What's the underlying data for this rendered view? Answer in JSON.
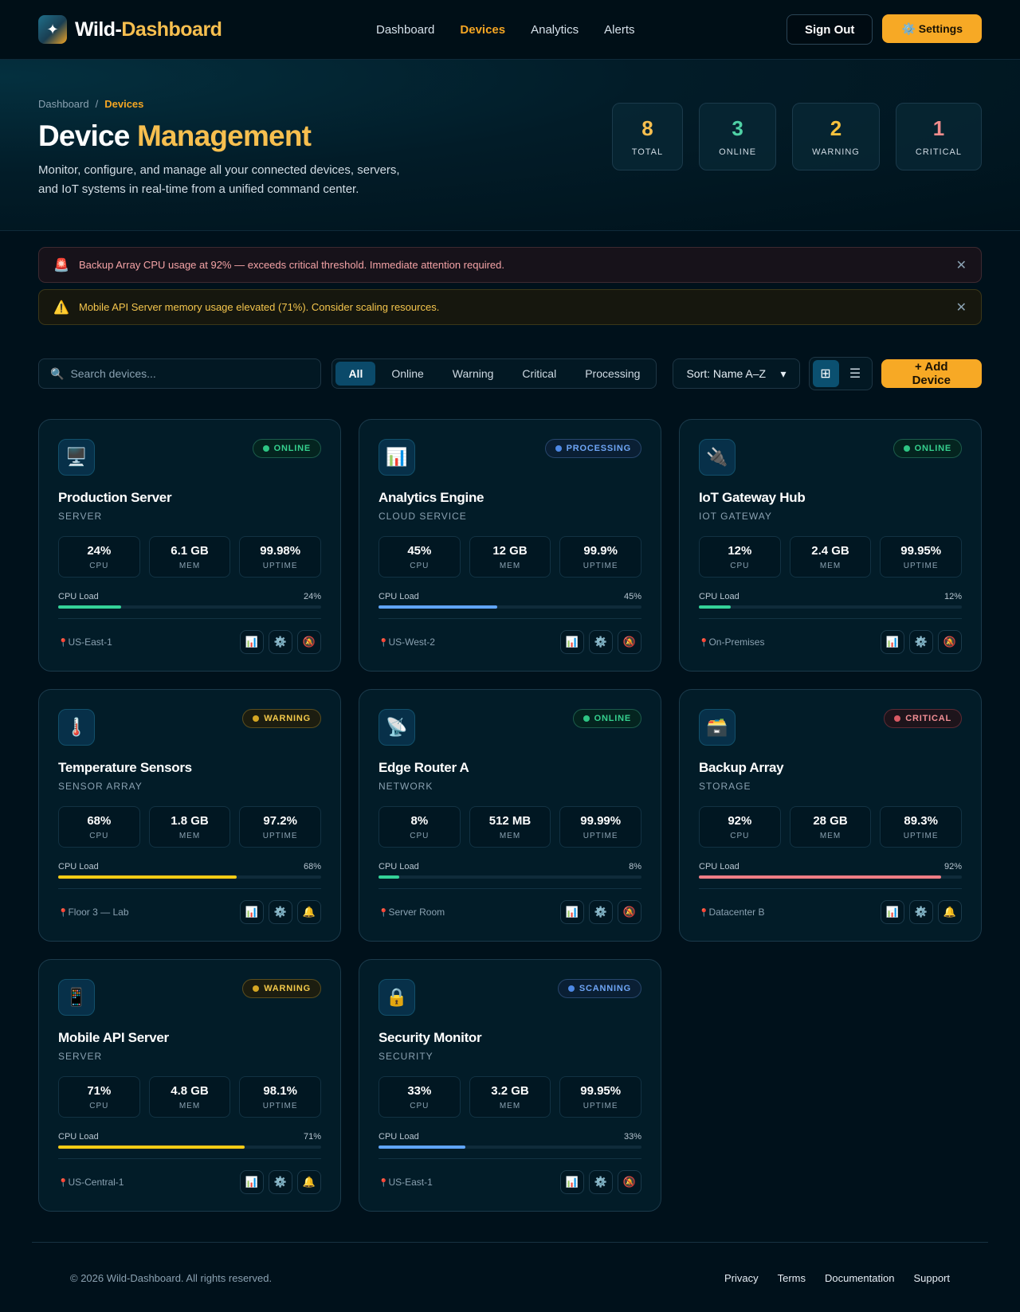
{
  "header": {
    "brand_logo_glyph": "✦",
    "brand_name_part1": "Wild-",
    "brand_name_part2": "Dashboard",
    "nav": [
      "Dashboard",
      "Devices",
      "Analytics",
      "Alerts"
    ],
    "active_nav": "Devices",
    "sign_out_label": "Sign Out",
    "settings_label": "⚙️ Settings"
  },
  "hero": {
    "breadcrumb_root": "Dashboard",
    "breadcrumb_sep": "/",
    "breadcrumb_current": "Devices",
    "title_part1": "Device",
    "title_part2": "Management",
    "description": "Monitor, configure, and manage all your connected devices, servers, and IoT systems in real-time from a unified command center.",
    "stats": [
      {
        "value": "8",
        "label": "TOTAL",
        "color": "#f7bf4f"
      },
      {
        "value": "3",
        "label": "ONLINE",
        "color": "#4fd1a5"
      },
      {
        "value": "2",
        "label": "WARNING",
        "color": "#f5c13d"
      },
      {
        "value": "1",
        "label": "CRITICAL",
        "color": "#f08c8c"
      }
    ]
  },
  "alerts": [
    {
      "level": "critical",
      "icon": "🚨",
      "text": "Backup Array CPU usage at 92% — exceeds critical threshold. Immediate attention required.",
      "close": "✕"
    },
    {
      "level": "warning",
      "icon": "⚠️",
      "text": "Mobile API Server memory usage elevated (71%). Consider scaling resources.",
      "close": "✕"
    }
  ],
  "toolbar": {
    "search_icon": "🔍",
    "search_placeholder": "Search devices...",
    "filters": [
      "All",
      "Online",
      "Warning",
      "Critical",
      "Processing"
    ],
    "active_filter": "All",
    "sort_value": "Sort: Name A–Z",
    "sort_arrow": "▾",
    "grid_icon": "⊞",
    "list_icon": "☰",
    "add_label": "+  Add Device"
  },
  "devices": [
    {
      "icon": "🖥️",
      "name": "Production Server",
      "type": "SERVER",
      "status": "online",
      "status_label": "ONLINE",
      "cpu": "24%",
      "mem": "6.1 GB",
      "uptime": "99.98%",
      "load": 24,
      "load_label": "24%",
      "bar_color": "#34d399",
      "location": "US-East-1",
      "alert_icon": "🔕"
    },
    {
      "icon": "📊",
      "name": "Analytics Engine",
      "type": "CLOUD SERVICE",
      "status": "processing",
      "status_label": "PROCESSING",
      "cpu": "45%",
      "mem": "12 GB",
      "uptime": "99.9%",
      "load": 45,
      "load_label": "45%",
      "bar_color": "#60a5fa",
      "location": "US-West-2",
      "alert_icon": "🔕"
    },
    {
      "icon": "🔌",
      "name": "IoT Gateway Hub",
      "type": "IOT GATEWAY",
      "status": "online",
      "status_label": "ONLINE",
      "cpu": "12%",
      "mem": "2.4 GB",
      "uptime": "99.95%",
      "load": 12,
      "load_label": "12%",
      "bar_color": "#34d399",
      "location": "On-Premises",
      "alert_icon": "🔕"
    },
    {
      "icon": "🌡️",
      "name": "Temperature Sensors",
      "type": "SENSOR ARRAY",
      "status": "warning",
      "status_label": "WARNING",
      "cpu": "68%",
      "mem": "1.8 GB",
      "uptime": "97.2%",
      "load": 68,
      "load_label": "68%",
      "bar_color": "#facc15",
      "location": "Floor 3 — Lab",
      "alert_icon": "🔔"
    },
    {
      "icon": "📡",
      "name": "Edge Router A",
      "type": "NETWORK",
      "status": "online",
      "status_label": "ONLINE",
      "cpu": "8%",
      "mem": "512 MB",
      "uptime": "99.99%",
      "load": 8,
      "load_label": "8%",
      "bar_color": "#34d399",
      "location": "Server Room",
      "alert_icon": "🔕"
    },
    {
      "icon": "🗃️",
      "name": "Backup Array",
      "type": "STORAGE",
      "status": "critical",
      "status_label": "CRITICAL",
      "cpu": "92%",
      "mem": "28 GB",
      "uptime": "89.3%",
      "load": 92,
      "load_label": "92%",
      "bar_color": "#f07e86",
      "location": "Datacenter B",
      "alert_icon": "🔔"
    },
    {
      "icon": "📱",
      "name": "Mobile API Server",
      "type": "SERVER",
      "status": "warning",
      "status_label": "WARNING",
      "cpu": "71%",
      "mem": "4.8 GB",
      "uptime": "98.1%",
      "load": 71,
      "load_label": "71%",
      "bar_color": "#facc15",
      "location": "US-Central-1",
      "alert_icon": "🔔"
    },
    {
      "icon": "🔒",
      "name": "Security Monitor",
      "type": "SECURITY",
      "status": "scanning",
      "status_label": "SCANNING",
      "cpu": "33%",
      "mem": "3.2 GB",
      "uptime": "99.95%",
      "load": 33,
      "load_label": "33%",
      "bar_color": "#60a5fa",
      "location": "US-East-1",
      "alert_icon": "🔕"
    }
  ],
  "card_labels": {
    "cpu": "CPU",
    "mem": "MEM",
    "uptime": "UPTIME",
    "load": "CPU Load",
    "pin": "📍",
    "chart_icon": "📊",
    "settings_icon": "⚙️"
  },
  "footer": {
    "copyright": "© 2026 Wild-Dashboard. All rights reserved.",
    "links": [
      "Privacy",
      "Terms",
      "Documentation",
      "Support"
    ]
  }
}
